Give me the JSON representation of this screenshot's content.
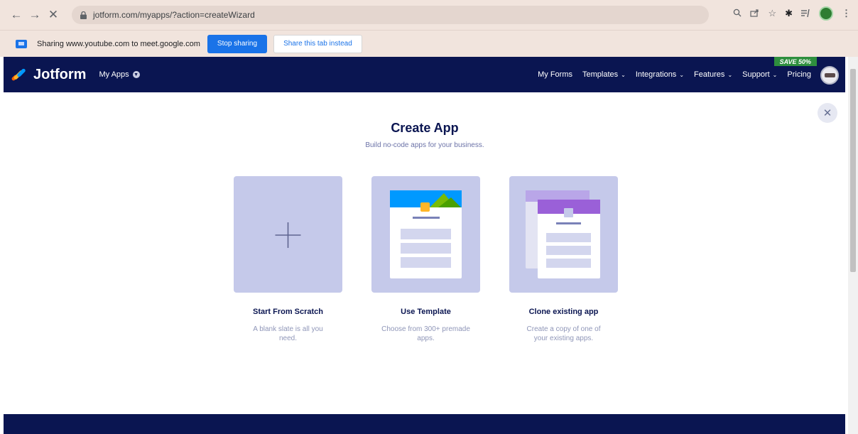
{
  "browser": {
    "url": "jotform.com/myapps/?action=createWizard",
    "back_icon": "back-arrow-icon",
    "forward_icon": "forward-arrow-icon",
    "stop_icon": "close-icon"
  },
  "share_bar": {
    "message": "Sharing www.youtube.com to meet.google.com",
    "stop_label": "Stop sharing",
    "share_tab_label": "Share this tab instead"
  },
  "header": {
    "logo_text": "Jotform",
    "my_apps": "My Apps",
    "save_badge": "SAVE 50%",
    "nav": {
      "my_forms": "My Forms",
      "templates": "Templates",
      "integrations": "Integrations",
      "features": "Features",
      "support": "Support",
      "pricing": "Pricing"
    }
  },
  "main": {
    "title": "Create App",
    "subtitle": "Build no-code apps for your business.",
    "close_glyph": "✕",
    "cards": [
      {
        "title": "Start From Scratch",
        "desc": "A blank slate is all you need."
      },
      {
        "title": "Use Template",
        "desc": "Choose from 300+ premade apps."
      },
      {
        "title": "Clone existing app",
        "desc": "Create a copy of one of your existing apps."
      }
    ]
  },
  "colors": {
    "navy": "#0a1551",
    "card_bg": "#c5c9ea",
    "accent_blue": "#1a73e8",
    "save_green": "#2e8f3e"
  }
}
